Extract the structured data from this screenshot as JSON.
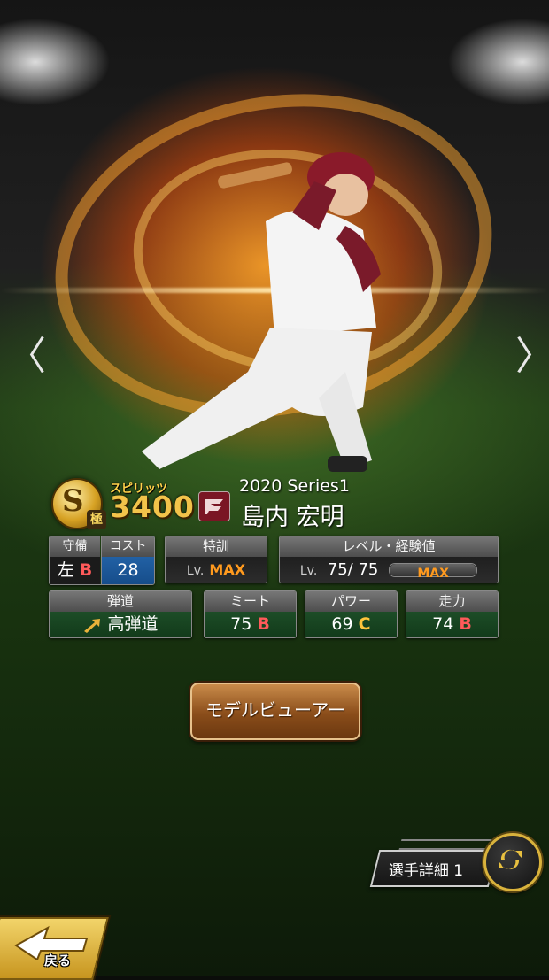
{
  "nav": {
    "prev_glyph": "〈",
    "next_glyph": "〉"
  },
  "card": {
    "rank_letter": "S",
    "rank_mark": "極",
    "spirit_label": "スピリッツ",
    "spirit_value": "3400",
    "series": "2020 Series1",
    "player_name": "島内 宏明",
    "team_logo": "eagles-logo-icon"
  },
  "stats": {
    "defense": {
      "label": "守備",
      "hand": "左",
      "grade": "B"
    },
    "cost": {
      "label": "コスト",
      "value": "28"
    },
    "training": {
      "label": "特訓",
      "lv_prefix": "Lv.",
      "value": "MAX"
    },
    "level": {
      "label": "レベル・経験値",
      "lv_prefix": "Lv.",
      "current": "75",
      "sep": "/",
      "max": "75",
      "exp_label": "MAX",
      "exp_fill": 1.0
    },
    "trajectory": {
      "label": "弾道",
      "value": "高弾道",
      "icon": "arrow-up-right-icon"
    },
    "meet": {
      "label": "ミート",
      "value": "75",
      "grade": "B"
    },
    "power": {
      "label": "パワー",
      "value": "69",
      "grade": "C"
    },
    "speed": {
      "label": "走力",
      "value": "74",
      "grade": "B"
    }
  },
  "buttons": {
    "model_viewer": "モデルビューアー",
    "player_detail": "選手詳細 1",
    "back": "戻る"
  },
  "colors": {
    "grade_b": "#ff5a5a",
    "grade_c": "#ffc43b",
    "max": "#ff9a1e",
    "spirit": "#f2c34a"
  }
}
